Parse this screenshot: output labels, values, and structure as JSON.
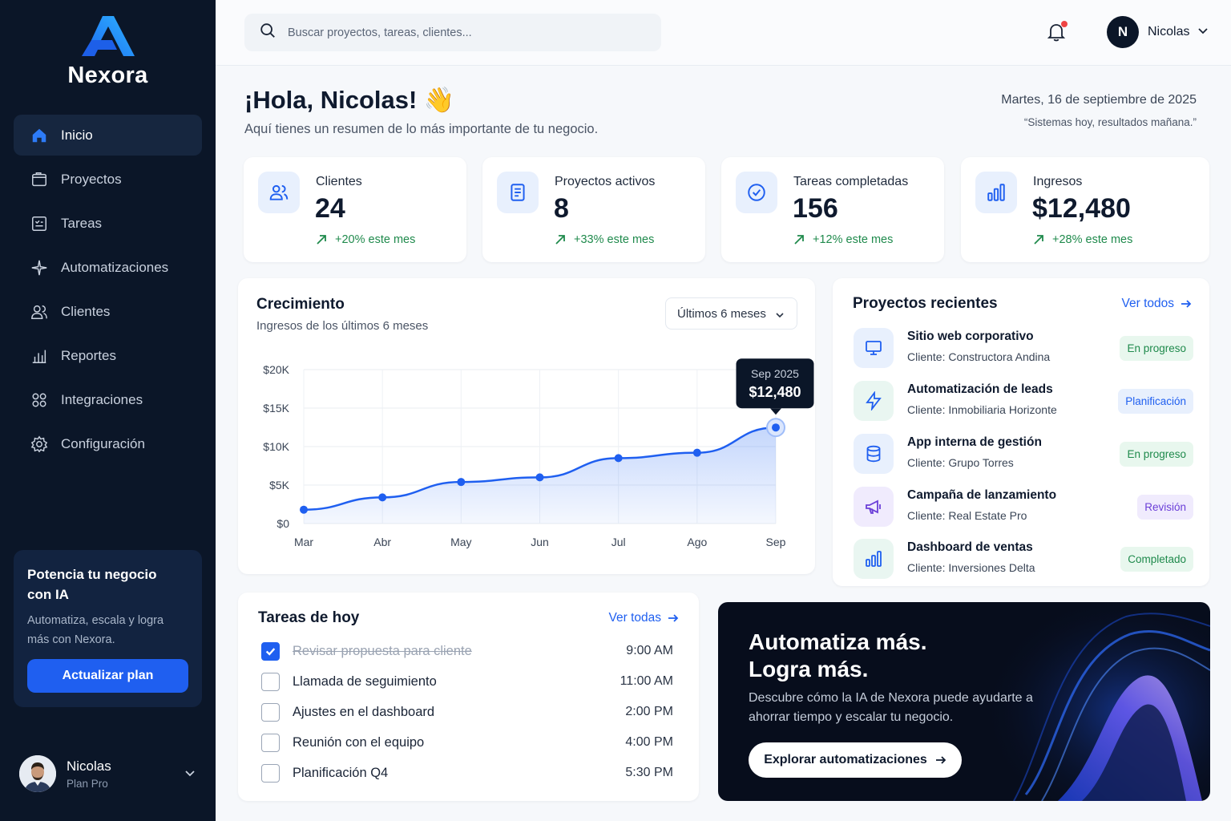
{
  "app": {
    "name": "Nexora"
  },
  "sidebar": {
    "items": [
      {
        "label": "Inicio",
        "icon": "home-icon",
        "active": true
      },
      {
        "label": "Proyectos",
        "icon": "folder-icon",
        "active": false
      },
      {
        "label": "Tareas",
        "icon": "tasks-icon",
        "active": false
      },
      {
        "label": "Automatizaciones",
        "icon": "sparkle-icon",
        "active": false
      },
      {
        "label": "Clientes",
        "icon": "users-icon",
        "active": false
      },
      {
        "label": "Reportes",
        "icon": "bar-chart-icon",
        "active": false
      },
      {
        "label": "Integraciones",
        "icon": "grid-icon",
        "active": false
      },
      {
        "label": "Configuración",
        "icon": "gear-icon",
        "active": false
      }
    ],
    "promo": {
      "title": "Potencia tu negocio con IA",
      "text": "Automatiza, escala y logra más con Nexora.",
      "button": "Actualizar plan"
    },
    "user": {
      "name": "Nicolas",
      "plan": "Plan Pro"
    }
  },
  "topbar": {
    "search_placeholder": "Buscar proyectos, tareas, clientes...",
    "notification_dot": true,
    "user_initial": "N",
    "user_name": "Nicolas"
  },
  "greeting": {
    "title": "¡Hola, Nicolas! 👋",
    "subtitle": "Aquí tienes un resumen de lo más importante de tu negocio.",
    "date": "Martes, 16 de septiembre de 2025",
    "quote": "“Sistemas hoy, resultados mañana.”"
  },
  "stats": [
    {
      "label": "Clientes",
      "value": "24",
      "trend": "+20% este mes",
      "icon": "users-icon"
    },
    {
      "label": "Proyectos activos",
      "value": "8",
      "trend": "+33% este mes",
      "icon": "document-icon"
    },
    {
      "label": "Tareas completadas",
      "value": "156",
      "trend": "+12% este mes",
      "icon": "check-circle-icon"
    },
    {
      "label": "Ingresos",
      "value": "$12,480",
      "trend": "+28% este mes",
      "icon": "bar-chart-icon"
    }
  ],
  "growth": {
    "title": "Crecimiento",
    "subtitle": "Ingresos de los últimos 6 meses",
    "range": "Últimos 6 meses",
    "tooltip": {
      "label": "Sep 2025",
      "value": "$12,480"
    }
  },
  "chart_data": {
    "type": "area",
    "categories": [
      "Mar",
      "Abr",
      "May",
      "Jun",
      "Jul",
      "Ago",
      "Sep"
    ],
    "values": [
      1800,
      3400,
      5400,
      6000,
      8500,
      9200,
      12480
    ],
    "ylim": [
      0,
      20000
    ],
    "yticks": [
      "$0",
      "$5K",
      "$10K",
      "$15K",
      "$20K"
    ],
    "grid": true,
    "color": "#1f5ff0"
  },
  "projects": {
    "title": "Proyectos recientes",
    "link": "Ver todos",
    "items": [
      {
        "name": "Sitio web corporativo",
        "client": "Cliente: Constructora Andina",
        "status": "En progreso",
        "icon": "monitor-icon",
        "status_color": "#1f8a4c",
        "status_bg": "#e8f7ee",
        "icon_color": "#1f5ff0",
        "icon_bg": "#e8f0fd"
      },
      {
        "name": "Automatización de leads",
        "client": "Cliente: Inmobiliaria Horizonte",
        "status": "Planificación",
        "icon": "lightning-icon",
        "status_color": "#1f5ff0",
        "status_bg": "#e8f0fd",
        "icon_color": "#1f5ff0",
        "icon_bg": "#e9f6f1"
      },
      {
        "name": "App interna de gestión",
        "client": "Cliente: Grupo Torres",
        "status": "En progreso",
        "icon": "database-icon",
        "status_color": "#1f8a4c",
        "status_bg": "#e8f7ee",
        "icon_color": "#1f5ff0",
        "icon_bg": "#e8f0fd"
      },
      {
        "name": "Campaña de lanzamiento",
        "client": "Cliente: Real Estate Pro",
        "status": "Revisión",
        "icon": "megaphone-icon",
        "status_color": "#6b3fd8",
        "status_bg": "#f0ebfd",
        "icon_color": "#6b3fd8",
        "icon_bg": "#f0ebfd"
      },
      {
        "name": "Dashboard de ventas",
        "client": "Cliente: Inversiones Delta",
        "status": "Completado",
        "icon": "bar-chart-icon",
        "status_color": "#1f8a4c",
        "status_bg": "#e8f7ee",
        "icon_color": "#1f5ff0",
        "icon_bg": "#e9f6f1"
      }
    ]
  },
  "tasks": {
    "title": "Tareas de hoy",
    "link": "Ver todas",
    "items": [
      {
        "label": "Revisar propuesta para cliente",
        "time": "9:00 AM",
        "done": true
      },
      {
        "label": "Llamada de seguimiento",
        "time": "11:00 AM",
        "done": false
      },
      {
        "label": "Ajustes en el dashboard",
        "time": "2:00 PM",
        "done": false
      },
      {
        "label": "Reunión con el equipo",
        "time": "4:00 PM",
        "done": false
      },
      {
        "label": "Planificación Q4",
        "time": "5:30 PM",
        "done": false
      }
    ]
  },
  "banner": {
    "title": "Automatiza más. Logra más.",
    "text": "Descubre cómo la IA de Nexora puede ayudarte a ahorrar tiempo y escalar tu negocio.",
    "button": "Explorar automatizaciones"
  },
  "colors": {
    "accent": "#1f5ff0",
    "sidebar": "#0b1628",
    "success": "#1f8a4c"
  }
}
